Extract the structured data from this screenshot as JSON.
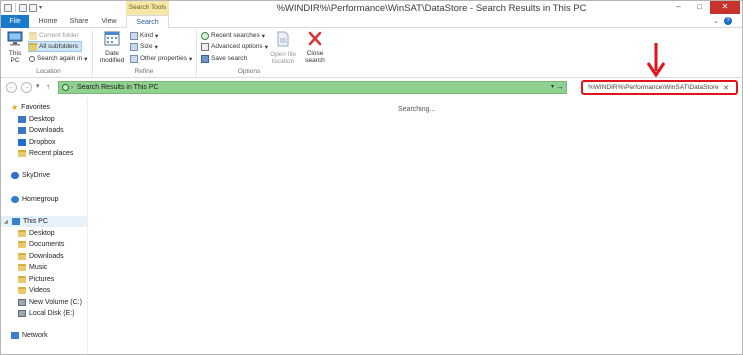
{
  "window": {
    "title": "%WINDIR%\\Performance\\WinSAT\\DataStore - Search Results in This PC",
    "context_tab": "Search Tools",
    "minimize": "–",
    "maximize": "□",
    "close": "✕"
  },
  "ribbon_tabs": [
    "File",
    "Home",
    "Share",
    "View",
    "Search"
  ],
  "ribbon": {
    "location": {
      "this_pc": "This\nPC",
      "current_folder": "Current folder",
      "all_subfolders": "All subfolders",
      "search_again_in": "Search again in",
      "label": "Location"
    },
    "refine": {
      "date_modified": "Date\nmodified",
      "kind": "Kind",
      "size": "Size",
      "other_properties": "Other properties",
      "label": "Refine"
    },
    "options": {
      "recent_searches": "Recent searches",
      "advanced_options": "Advanced options",
      "save_search": "Save search",
      "open_file_location": "Open file\nlocation",
      "label": "Options"
    },
    "close_search": "Close\nsearch"
  },
  "address_bar": {
    "path": "Search Results in This PC",
    "search_query": "%WINDIR%\\Performance\\WinSAT\\DataStore"
  },
  "nav_pane": {
    "favorites": "Favorites",
    "favorites_items": [
      "Desktop",
      "Downloads",
      "Dropbox",
      "Recent places"
    ],
    "skydrive": "SkyDrive",
    "homegroup": "Homegroup",
    "this_pc": "This PC",
    "this_pc_items": [
      "Desktop",
      "Documents",
      "Downloads",
      "Music",
      "Pictures",
      "Videos",
      "New Volume (C:)",
      "Local Disk (E:)"
    ],
    "network": "Network"
  },
  "content": {
    "status": "Searching..."
  },
  "colors": {
    "file_tab": "#1979ca",
    "address_progress": "#8fd18f",
    "highlight_box": "#e0141b",
    "context_tab": "#f6e7a8",
    "close_button": "#c7332c"
  }
}
